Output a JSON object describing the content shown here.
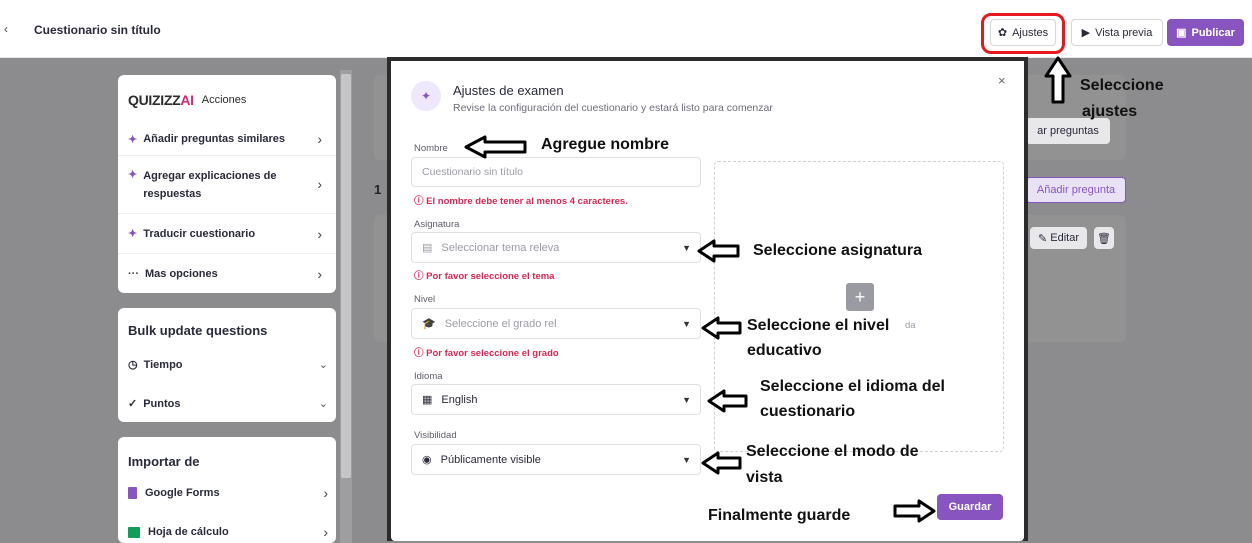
{
  "header": {
    "back": "‹",
    "title": "Cuestionario sin título",
    "settings_label": "Ajustes",
    "preview_label": "Vista previa",
    "publish_label": "Publicar"
  },
  "sidebar": {
    "brand": "QUIZIZZ",
    "brand_ai": "AI",
    "brand_actions": "Acciones",
    "actions": [
      {
        "label": "Añadir preguntas similares"
      },
      {
        "label": "Agregar explicaciones de respuestas"
      },
      {
        "label": "Traducir cuestionario"
      },
      {
        "label": "Mas opciones"
      }
    ],
    "bulk_title": "Bulk update questions",
    "bulk_items": [
      {
        "label": "Tiempo"
      },
      {
        "label": "Puntos"
      }
    ],
    "import_title": "Importar de",
    "import_items": [
      {
        "label": "Google Forms"
      },
      {
        "label": "Hoja de cálculo"
      }
    ]
  },
  "background": {
    "question_number": "1",
    "search_questions": "ar preguntas",
    "add_question": "Añadir pregunta",
    "edit": "Editar"
  },
  "modal": {
    "title": "Ajustes de examen",
    "subtitle": "Revise la configuración del cuestionario y estará listo para comenzar",
    "close": "×",
    "name_label": "Nombre",
    "name_placeholder": "Cuestionario sin título",
    "name_error": "El nombre debe tener al menos 4 caracteres.",
    "subject_label": "Asignatura",
    "subject_placeholder": "Seleccionar tema releva",
    "subject_error": "Por favor seleccione el tema",
    "level_label": "Nivel",
    "level_placeholder": "Seleccione el grado rel",
    "level_error": "Por favor seleccione el grado",
    "language_label": "Idioma",
    "language_value": "English",
    "visibility_label": "Visibilidad",
    "visibility_value": "Públicamente visible",
    "dropzone_text": "da",
    "add_image": "+",
    "save_label": "Guardar"
  },
  "annotations": {
    "select_settings_1": "Seleccione",
    "select_settings_2": "ajustes",
    "add_name": "Agregue nombre",
    "select_subject": "Seleccione asignatura",
    "select_level_1": "Seleccione el nivel",
    "select_level_2": "educativo",
    "select_language_1": "Seleccione el idioma del",
    "select_language_2": "cuestionario",
    "select_view_1": "Seleccione el modo de",
    "select_view_2": "vista",
    "finally_save": "Finalmente guarde"
  },
  "colors": {
    "accent": "#8854c0",
    "error": "#e02552",
    "highlight": "#e6181e"
  }
}
